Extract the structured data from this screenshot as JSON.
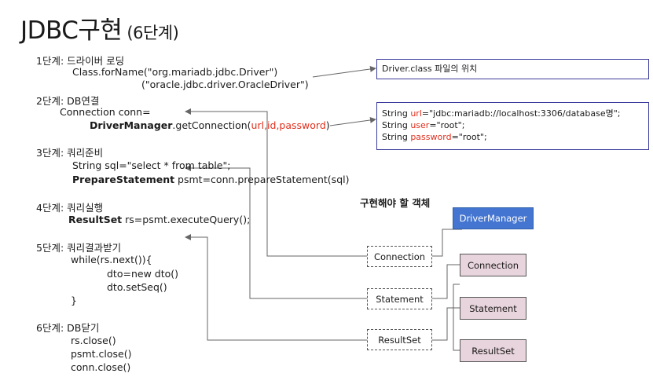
{
  "title": {
    "main": "JDBC구현",
    "sub": "(6단계)"
  },
  "steps": {
    "s1": {
      "label": "1단계: 드라이버 로딩",
      "line1": "Class.forName(\"org.mariadb.jdbc.Driver\")",
      "line2": "(\"oracle.jdbc.driver.OracleDriver\")"
    },
    "s2": {
      "label": "2단계: DB연결",
      "line1": "Connection conn=",
      "dm": "DriverManager",
      "getconn": ".getConnection(",
      "args": "url,id,password",
      "close": ")"
    },
    "s3": {
      "label": "3단계: 쿼리준비",
      "line1": "String sql=\"select * from table\";",
      "ps": "PrepareStatement",
      "line2rest": " psmt=conn.prepareStatement(sql)"
    },
    "s4": {
      "label": "4단계: 쿼리실행",
      "rs": "ResultSet",
      "line1rest": " rs=psmt.executeQuery();"
    },
    "s5": {
      "label": "5단계: 쿼리결과받기",
      "line1": "while(rs.next()){",
      "line2": "dto=new dto()",
      "line3": "dto.setSeq()",
      "line4": "}"
    },
    "s6": {
      "label": "6단계: DB닫기",
      "line1": "rs.close()",
      "line2": "psmt.close()",
      "line3": "conn.close()"
    }
  },
  "info1": {
    "text": "Driver.class 파일의 위치"
  },
  "info2": {
    "l1a": "String ",
    "l1b": "url",
    "l1c": "=\"jdbc:mariadb://localhost:3306/database명\";",
    "l2a": "String ",
    "l2b": "user",
    "l2c": "=\"root\";",
    "l3a": "String ",
    "l3b": "password",
    "l3c": "=\"root\";"
  },
  "diagram": {
    "heading": "구현해야 할 객체",
    "driver_manager": "DriverManager",
    "connection_iface": "Connection",
    "statement_iface": "Statement",
    "resultset_iface": "ResultSet",
    "connection_impl": "Connection",
    "statement_impl": "Statement",
    "resultset_impl": "ResultSet"
  },
  "colors": {
    "red": "#e0301e",
    "blue_box": "#4475d0",
    "pink_box": "#e8d4dc",
    "info_border": "#3c3c9c"
  }
}
